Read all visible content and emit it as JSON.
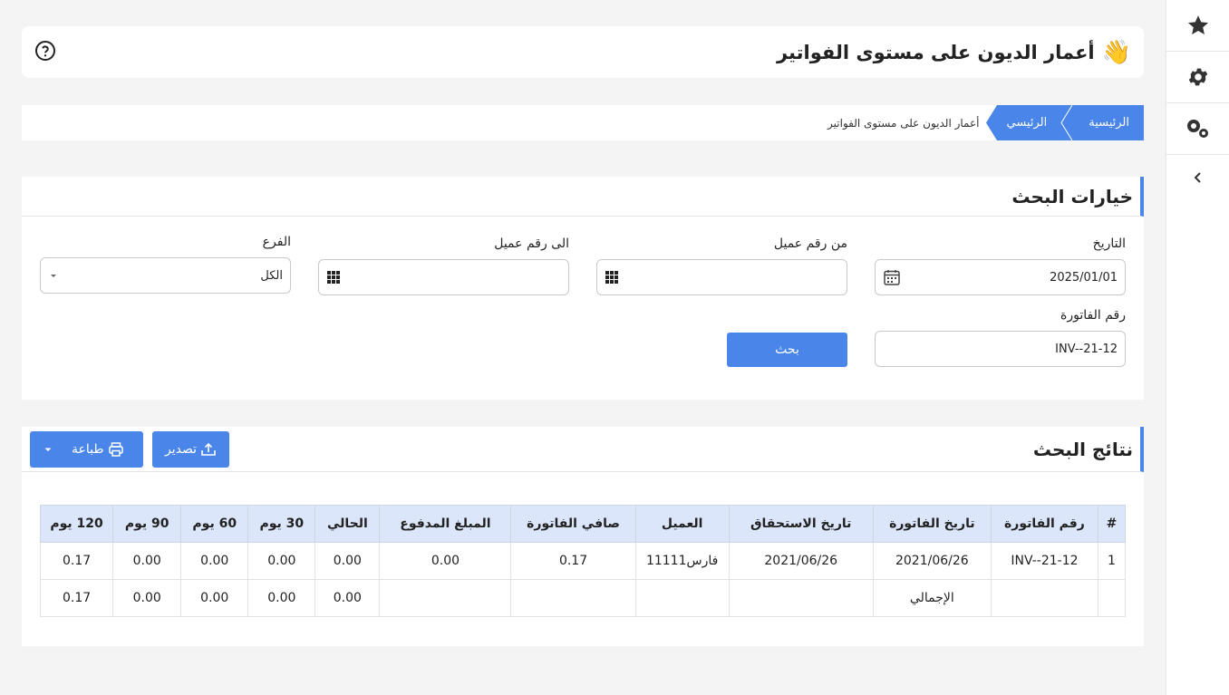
{
  "header": {
    "title": "أعمار الديون على مستوى الفواتير",
    "wave_icon": "waving-hand-icon"
  },
  "breadcrumb": {
    "items": [
      "الرئيسية",
      "الرئيسي"
    ],
    "current": "أعمار الديون على مستوى الفواتير"
  },
  "search": {
    "title": "خيارات البحث",
    "date_label": "التاريخ",
    "date_value": "2025/01/01",
    "from_customer_label": "من رقم عميل",
    "from_customer_value": "",
    "to_customer_label": "الى رقم عميل",
    "to_customer_value": "",
    "branch_label": "الفرع",
    "branch_value": "الكل",
    "invoice_label": "رقم الفاتورة",
    "invoice_value": "INV--21-12",
    "search_button": "بحث"
  },
  "results": {
    "title": "نتائج البحث",
    "export_button": "تصدير",
    "print_button": "طباعة",
    "columns": [
      "#",
      "رقم الفاتورة",
      "تاريخ الفاتورة",
      "تاريخ الاستحقاق",
      "العميل",
      "صافي الفاتورة",
      "المبلغ المدفوع",
      "الحالي",
      "30 يوم",
      "60 يوم",
      "90 يوم",
      "120 يوم"
    ],
    "rows": [
      [
        "1",
        "INV--21-12",
        "2021/06/26",
        "2021/06/26",
        "فارس11111",
        "0.17",
        "0.00",
        "0.00",
        "0.00",
        "0.00",
        "0.00",
        "0.17"
      ]
    ],
    "total": [
      "",
      "",
      "الإجمالي",
      "",
      "",
      "",
      "",
      "0.00",
      "0.00",
      "0.00",
      "0.00",
      "0.17"
    ]
  },
  "colors": {
    "accent": "#4a86ea",
    "header_bg": "#dbe6fb"
  }
}
